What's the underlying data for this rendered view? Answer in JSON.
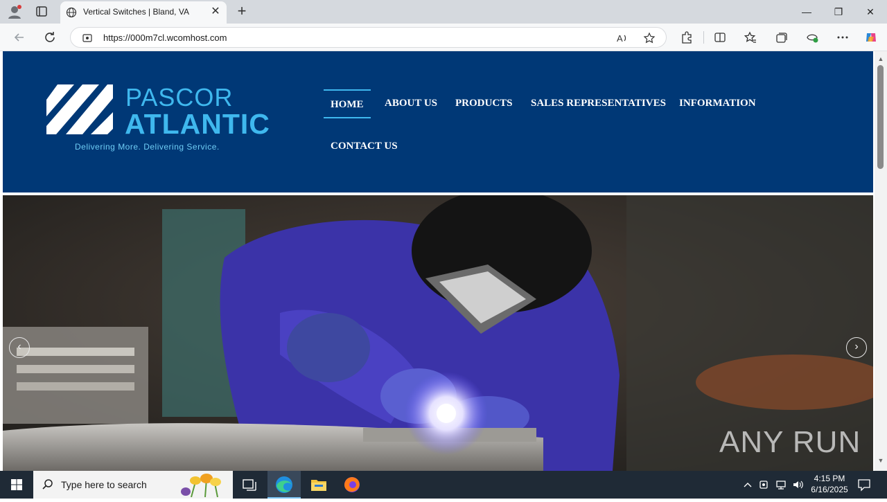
{
  "browser": {
    "tab_title": "Vertical Switches | Bland, VA",
    "url": "https://000m7cl.wcomhost.com",
    "new_tab_symbol": "+",
    "close_tab_symbol": "✕",
    "window_controls": [
      "—",
      "❐",
      "✕"
    ]
  },
  "site": {
    "logo": {
      "line1": "PASCOR",
      "line2": "ATLANTIC",
      "tagline": "Delivering More. Delivering Service."
    },
    "nav": [
      {
        "label": "HOME",
        "active": true
      },
      {
        "label": "ABOUT US",
        "active": false
      },
      {
        "label": "PRODUCTS",
        "active": false
      },
      {
        "label": "SALES REPRESENTATIVES",
        "active": false
      },
      {
        "label": "INFORMATION",
        "active": false
      },
      {
        "label": "CONTACT US",
        "active": false
      }
    ],
    "hero": {
      "prev_symbol": "‹",
      "next_symbol": "›",
      "watermark": "ANY RUN"
    },
    "colors": {
      "header_bg": "#003876",
      "brand_cyan": "#3fb8ee"
    }
  },
  "taskbar": {
    "search_placeholder": "Type here to search",
    "time": "4:15 PM",
    "date": "6/16/2025"
  }
}
